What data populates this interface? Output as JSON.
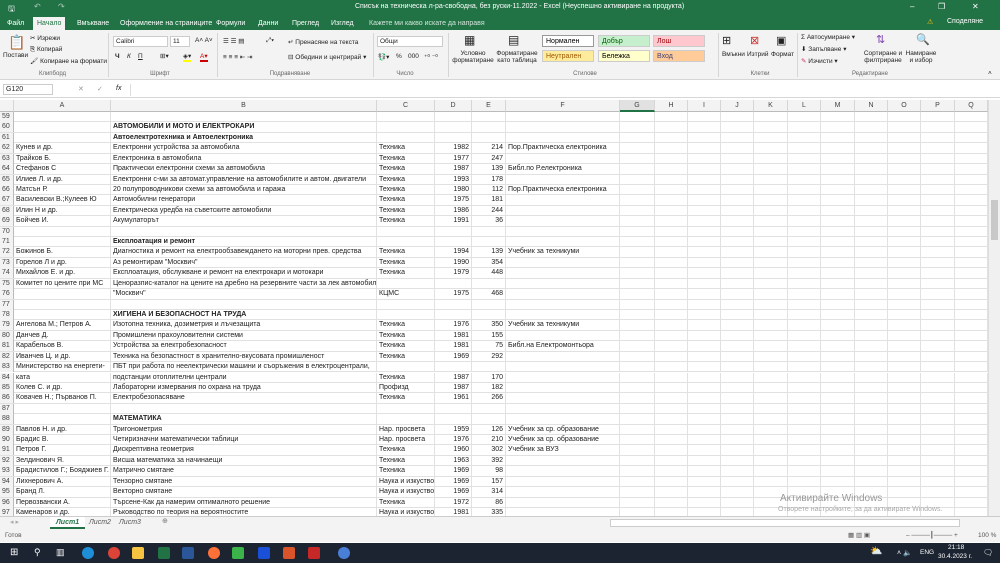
{
  "window": {
    "title": "Списък на техническа л-ра-свободна, без руски-11.2022 - Excel (Неуспешно активиране на продукта)",
    "share": "Споделяне"
  },
  "tabs": [
    "Файл",
    "Начало",
    "Вмъкване",
    "Оформление на страниците",
    "Формули",
    "Данни",
    "Преглед",
    "Изглед"
  ],
  "tell_me": "Кажете ми какво искате да направя",
  "ribbon": {
    "clipboard": {
      "paste": "Постави",
      "cut": "Изрежи",
      "copy": "Копирай",
      "format_painter": "Копиране на формати",
      "group": "Клипборд"
    },
    "font": {
      "name": "Calibri",
      "size": "11",
      "bold": "Ч",
      "italic": "К",
      "underline": "П",
      "group": "Шрифт"
    },
    "alignment": {
      "wrap": "Пренасяне на текста",
      "merge": "Обедини и центрирай",
      "group": "Подравняване"
    },
    "number": {
      "format": "Общи",
      "percent": "%",
      "thousands": "000",
      "group": "Число"
    },
    "styles": {
      "cond": "Условно форматиране",
      "table": "Форматиране като таблица",
      "items": [
        "Нормален",
        "Добър",
        "Лош",
        "Неутрален",
        "Бележка",
        "Вход"
      ],
      "group": "Стилове"
    },
    "cells": {
      "insert": "Вмъкни",
      "delete": "Изтрий",
      "format": "Формат",
      "group": "Клетки"
    },
    "editing": {
      "autosum": "Автосумиране",
      "fill": "Запълване",
      "clear": "Изчисти",
      "sort": "Сортиране и филтриране",
      "find": "Намиране и избор",
      "group": "Редактиране"
    }
  },
  "formula_bar": {
    "name_box": "G120",
    "fx": "fx",
    "value": ""
  },
  "columns": [
    "A",
    "B",
    "C",
    "D",
    "E",
    "F",
    "G",
    "H",
    "I",
    "J",
    "K",
    "L",
    "M",
    "N",
    "O",
    "P",
    "Q"
  ],
  "rows": [
    {
      "n": "59",
      "a": "",
      "b": "",
      "c": "",
      "d": "",
      "e": "",
      "f": ""
    },
    {
      "n": "60",
      "a": "",
      "b": "АВТОМОБИЛИ И МОТО И ЕЛЕКТРОКАРИ",
      "c": "",
      "d": "",
      "e": "",
      "f": "",
      "bold": true
    },
    {
      "n": "61",
      "a": "",
      "b": "Автоелектротехника и Автоелектроника",
      "c": "",
      "d": "",
      "e": "",
      "f": "",
      "bold": true
    },
    {
      "n": "62",
      "a": "Кунев и др.",
      "b": "Електронни устройства за автомобила",
      "c": "Техника",
      "d": "1982",
      "e": "214",
      "f": "Пор.Практическа електроника"
    },
    {
      "n": "63",
      "a": "Трайков Б.",
      "b": "Електроника в автомобила",
      "c": "Техника",
      "d": "1977",
      "e": "247",
      "f": ""
    },
    {
      "n": "64",
      "a": "Стефанов С",
      "b": "Практически електронни схеми за автомобила",
      "c": "Техника",
      "d": "1987",
      "e": "139",
      "f": "Библ.по Р.електроника"
    },
    {
      "n": "65",
      "a": "Илиев Л. и др.",
      "b": "Електронни с-ми за автомат.управление на автомобилите  и автом. двигатели",
      "c": "Техника",
      "d": "1993",
      "e": "178",
      "f": ""
    },
    {
      "n": "66",
      "a": "Матсън Р.",
      "b": "20 полупроводникови схеми за автомобила и гаража",
      "c": "Техника",
      "d": "1980",
      "e": "112",
      "f": "Пор.Практическа електроника"
    },
    {
      "n": "67",
      "a": "Василевски В.;Кулеев Ю",
      "b": "Автомобилни генератори",
      "c": "Техника",
      "d": "1975",
      "e": "181",
      "f": ""
    },
    {
      "n": "68",
      "a": "Илин Н и др.",
      "b": "Електрическа уредба на съветските автомобили",
      "c": "Техника",
      "d": "1986",
      "e": "244",
      "f": ""
    },
    {
      "n": "69",
      "a": "Бойчев И.",
      "b": "Акумулаторът",
      "c": "Техника",
      "d": "1991",
      "e": "36",
      "f": ""
    },
    {
      "n": "70",
      "a": "",
      "b": "",
      "c": "",
      "d": "",
      "e": "",
      "f": ""
    },
    {
      "n": "71",
      "a": "",
      "b": "Експлоатация и ремонт",
      "c": "",
      "d": "",
      "e": "",
      "f": "",
      "bold": true
    },
    {
      "n": "72",
      "a": "Божинов Б.",
      "b": "Диагностика и ремонт на електрообзавеждането на моторни прев. средства",
      "c": "Техника",
      "d": "1994",
      "e": "139",
      "f": "Учебник за техникуми"
    },
    {
      "n": "73",
      "a": "Горелов Л и др.",
      "b": "Аз ремонтирам \"Москвич\"",
      "c": "Техника",
      "d": "1990",
      "e": "354",
      "f": ""
    },
    {
      "n": "74",
      "a": "Михайлов Е. и др.",
      "b": "Експлоатация, обслужване и ремонт на електрокари и мотокари",
      "c": "Техника",
      "d": "1979",
      "e": "448",
      "f": ""
    },
    {
      "n": "75",
      "a": "Комитет по цените при МС",
      "b": "Ценоразпис-каталог на цените на дребно на резервните части за лек автомобил",
      "c": "",
      "d": "",
      "e": "",
      "f": ""
    },
    {
      "n": "76",
      "a": "",
      "b": "\"Москвич\"",
      "c": "КЦМС",
      "d": "1975",
      "e": "468",
      "f": ""
    },
    {
      "n": "77",
      "a": "",
      "b": "",
      "c": "",
      "d": "",
      "e": "",
      "f": ""
    },
    {
      "n": "78",
      "a": "",
      "b": "ХИГИЕНА И БЕЗОПАСНОСТ НА ТРУДА",
      "c": "",
      "d": "",
      "e": "",
      "f": "",
      "bold": true
    },
    {
      "n": "79",
      "a": "Ангелова М.; Петров А.",
      "b": "Изотопна техника, дозиметрия и лъчезащита",
      "c": "Техника",
      "d": "1976",
      "e": "350",
      "f": "Учебник за техникуми"
    },
    {
      "n": "80",
      "a": "Данчев Д.",
      "b": "Промишлени прахоуловителни системи",
      "c": "Техника",
      "d": "1981",
      "e": "155",
      "f": ""
    },
    {
      "n": "81",
      "a": "Карабельов В.",
      "b": "Устройства за електробезопасност",
      "c": "Техника",
      "d": "1981",
      "e": "75",
      "f": "Библ.на Електромонтьора"
    },
    {
      "n": "82",
      "a": "Иванчев Ц. и др.",
      "b": "Техника на безопастност в хранително-вкусовата промишленост",
      "c": "Техника",
      "d": "1969",
      "e": "292",
      "f": ""
    },
    {
      "n": "83",
      "a": "Министерство на енергети-",
      "b": "ПБТ при работа по неелектрически машини и съоръжения в електроцентрали,",
      "c": "",
      "d": "",
      "e": "",
      "f": ""
    },
    {
      "n": "84",
      "a": "ката",
      "b": "подстанции отоплителни централи",
      "c": "Техника",
      "d": "1987",
      "e": "170",
      "f": ""
    },
    {
      "n": "85",
      "a": "Колев С. и др.",
      "b": "Лабораторни измервания по охрана на труда",
      "c": "Профизд",
      "d": "1987",
      "e": "182",
      "f": ""
    },
    {
      "n": "86",
      "a": "Ковачев Н.; Първанов П.",
      "b": "Електробезопасяване",
      "c": "Техника",
      "d": "1961",
      "e": "266",
      "f": ""
    },
    {
      "n": "87",
      "a": "",
      "b": "",
      "c": "",
      "d": "",
      "e": "",
      "f": ""
    },
    {
      "n": "88",
      "a": "",
      "b": "МАТЕМАТИКА",
      "c": "",
      "d": "",
      "e": "",
      "f": "",
      "bold": true
    },
    {
      "n": "89",
      "a": "Павлов Н. и др.",
      "b": "Тригонометрия",
      "c": "Нар. просвета",
      "d": "1959",
      "e": "126",
      "f": "Учебник за ср. образование"
    },
    {
      "n": "90",
      "a": "Брадис В.",
      "b": "Четиризначни математически таблици",
      "c": "Нар. просвета",
      "d": "1976",
      "e": "210",
      "f": "Учебник за ср. образование"
    },
    {
      "n": "91",
      "a": "Петров Г.",
      "b": "Дискрептивна геометрия",
      "c": "Техника",
      "d": "1960",
      "e": "302",
      "f": "Учебник за ВУЗ"
    },
    {
      "n": "92",
      "a": "Зелдинович Я.",
      "b": "Висша математика за начинаещи",
      "c": "Техника",
      "d": "1963",
      "e": "392",
      "f": ""
    },
    {
      "n": "93",
      "a": "Брадистилов Г.; Бояджиев Г.",
      "b": "Матрично смятане",
      "c": "Техника",
      "d": "1969",
      "e": "98",
      "f": ""
    },
    {
      "n": "94",
      "a": "Лихнерович А.",
      "b": "Тензорно смятане",
      "c": "Наука и изкуство",
      "d": "1969",
      "e": "157",
      "f": ""
    },
    {
      "n": "95",
      "a": "Бранд Л.",
      "b": "Векторно смятане",
      "c": "Наука и изкуство",
      "d": "1969",
      "e": "314",
      "f": ""
    },
    {
      "n": "96",
      "a": "Первозвански А.",
      "b": "Търсене-Как да намерим оптималното решение",
      "c": "Техника",
      "d": "1972",
      "e": "86",
      "f": ""
    },
    {
      "n": "97",
      "a": "Каменаров и др.",
      "b": "Ръководство по теория на вероятностите",
      "c": "Наука и изкуство",
      "d": "1981",
      "e": "335",
      "f": ""
    }
  ],
  "sheets": [
    "Лист1",
    "Лист2",
    "Лист3"
  ],
  "status": {
    "ready": "Готов",
    "zoom": "100 %"
  },
  "watermark": {
    "title": "Активирайте Windows",
    "sub": "Отворете настройките, за да активирате Windows."
  },
  "taskbar": {
    "lang": "ENG",
    "time": "21:18",
    "date": "30.4.2023 г."
  },
  "colors": {
    "accent": "#217346",
    "good": "#c6efce",
    "bad": "#ffc7ce",
    "neutral": "#ffeb9c",
    "note": "#ffffcc",
    "input": "#ffcc99"
  }
}
